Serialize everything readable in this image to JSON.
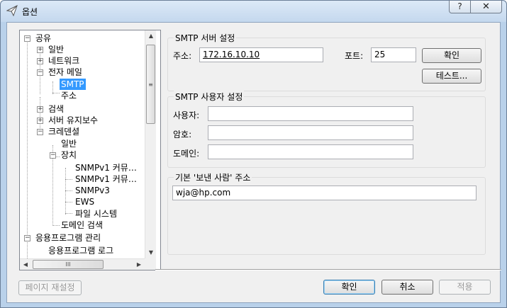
{
  "window": {
    "title": "옵션",
    "help_label": "?",
    "close_label": "✕"
  },
  "tree": {
    "items": [
      {
        "label": "공유",
        "toggle": "−"
      },
      {
        "label": "일반",
        "toggle": "+"
      },
      {
        "label": "네트워크",
        "toggle": "+"
      },
      {
        "label": "전자 메일",
        "toggle": "−"
      },
      {
        "label": "SMTP",
        "toggle": ""
      },
      {
        "label": "주소",
        "toggle": ""
      },
      {
        "label": "검색",
        "toggle": "+"
      },
      {
        "label": "서버 유지보수",
        "toggle": "+"
      },
      {
        "label": "크레덴셜",
        "toggle": "−"
      },
      {
        "label": "일반",
        "toggle": ""
      },
      {
        "label": "장치",
        "toggle": "−"
      },
      {
        "label": "SNMPv1 커뮤…",
        "toggle": ""
      },
      {
        "label": "SNMPv1 커뮤…",
        "toggle": ""
      },
      {
        "label": "SNMPv3",
        "toggle": ""
      },
      {
        "label": "EWS",
        "toggle": ""
      },
      {
        "label": "파일 시스템",
        "toggle": ""
      },
      {
        "label": "도메인 검색",
        "toggle": ""
      },
      {
        "label": "응용프로그램 관리",
        "toggle": "−"
      },
      {
        "label": "응용프로그램 로그",
        "toggle": ""
      }
    ],
    "selected_index": 4,
    "scroll_up": "▲",
    "scroll_down": "▼",
    "scroll_left": "◀",
    "scroll_right": "▶",
    "thumb_grip_v": "≡",
    "thumb_grip_h": "III"
  },
  "smtp_server": {
    "title": "SMTP 서버 설정",
    "address_label": "주소:",
    "address_value": "172.16.10.10",
    "port_label": "포트:",
    "port_value": "25",
    "ok_button": "확인",
    "test_button": "테스트..."
  },
  "smtp_user": {
    "title": "SMTP 사용자 설정",
    "user_label": "사용자:",
    "user_value": "",
    "password_label": "암호:",
    "password_value": "",
    "domain_label": "도메인:",
    "domain_value": ""
  },
  "sender": {
    "title": "기본 '보낸 사람' 주소",
    "value": "wja@hp.com"
  },
  "footer": {
    "reset_page": "페이지 재설정",
    "ok": "확인",
    "cancel": "취소",
    "apply": "적용"
  }
}
